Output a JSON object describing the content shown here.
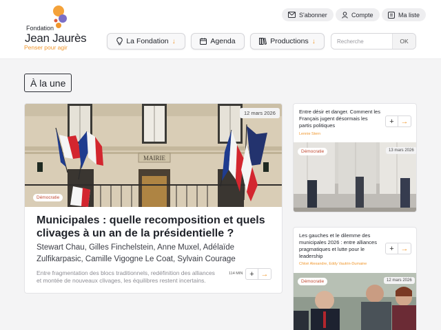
{
  "header": {
    "logo": {
      "top_line": "Fondation",
      "name": "Jean Jaurès",
      "tagline": "Penser pour agir"
    },
    "top_links": [
      {
        "label": "S'abonner",
        "icon": "mail-icon"
      },
      {
        "label": "Compte",
        "icon": "user-icon"
      },
      {
        "label": "Ma liste",
        "icon": "list-icon"
      }
    ],
    "nav": [
      {
        "label": "La Fondation",
        "icon": "bulb-icon",
        "chevron": "↓"
      },
      {
        "label": "Agenda",
        "icon": "calendar-icon"
      },
      {
        "label": "Productions",
        "icon": "books-icon",
        "chevron": "↓"
      }
    ],
    "search": {
      "placeholder": "Recherche",
      "button": "OK"
    }
  },
  "section": {
    "title": "À la une"
  },
  "featured": {
    "date": "12 mars 2026",
    "category": "Démocratie",
    "title": "Municipales : quelle recomposition et quels clivages à un an de la présidentielle ?",
    "authors": "Stewart Chau, Gilles Finchelstein, Anne Muxel, Adélaïde Zulfikarpasic, Camille Vigogne Le Coat, Sylvain Courage",
    "summary": "Entre fragmentation des blocs traditionnels, redéfinition des alliances et montée de nouveaux clivages, les équilibres restent incertains.",
    "read_time": "114 MIN",
    "image_label": "MAIRIE"
  },
  "side_articles": [
    {
      "title": "Entre désir et danger. Comment les Français jugent désormais les partis politiques",
      "authors": "Lennie Stern",
      "category": "Démocratie",
      "date": "13 mars 2026"
    },
    {
      "title": "Les gauches et le dilemme des municipales 2026 : entre alliances pragmatiques et lutte pour le leadership",
      "authors": "Chloé Alexandre, Eddy Vautrin-Dumaine",
      "category": "Démocratie",
      "date": "12 mars 2026"
    }
  ],
  "actions": {
    "plus": "+",
    "arrow": "→"
  },
  "colors": {
    "accent": "#f0972d",
    "category": "#c14a32",
    "text": "#1f2229",
    "background": "#f4f4f5"
  }
}
